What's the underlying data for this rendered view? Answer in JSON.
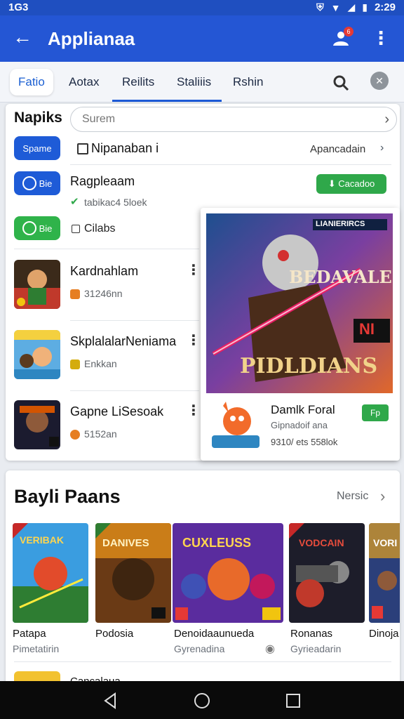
{
  "status": {
    "carrier": "1G3",
    "time": "2:29"
  },
  "appbar": {
    "title": "Applianaa",
    "badge": "6"
  },
  "tabs": [
    {
      "label": "Fatio"
    },
    {
      "label": "Aotax"
    },
    {
      "label": "Reilits"
    },
    {
      "label": "Staliiis"
    },
    {
      "label": "Rshin"
    }
  ],
  "section1": {
    "title": "Napiks",
    "search_placeholder": "Surem",
    "rows": [
      {
        "pill": "Spame",
        "label": "Nipanaban i",
        "link": "Apancadain"
      },
      {
        "pill": "Bie",
        "label": "Ragpleaam",
        "sub": "tabikac4 5loek",
        "button": "Cacadoo"
      },
      {
        "pill": "Bie",
        "label": "Cilabs"
      }
    ],
    "apps": [
      {
        "name": "Kardnahlam",
        "meta": "31246nn"
      },
      {
        "name": "SkplalalarNeniama",
        "meta": "Enkkan"
      },
      {
        "name": "Gapne LiSesoak",
        "meta": "5152an"
      }
    ]
  },
  "popup": {
    "art_title_top": "LIANIERIRCS",
    "art_title_mid": "BEDAVALEI",
    "art_title_bottom": "PIDLDIANS",
    "art_badge": "NI",
    "name": "Damlk Foral",
    "sub": "Gipnadoif ana",
    "meta": "9310/ ets 558lok",
    "button": "Fp"
  },
  "section2": {
    "title": "Bayli Paans",
    "more": "Nersic",
    "tiles": [
      {
        "art": "VERIBAK",
        "name": "Patapa",
        "sub": "Pimetatirin",
        "color1": "#3a9de0",
        "color2": "#e24b2b"
      },
      {
        "art": "DANIVES",
        "name": "Podosia",
        "sub": "",
        "color1": "#6a3a15",
        "color2": "#f39a1a"
      },
      {
        "art": "CUXLEUSS",
        "name": "Denoidaaunueda",
        "sub": "Gyrenadina",
        "color1": "#5a2c9e",
        "color2": "#e86a2a"
      },
      {
        "art": "VODCAIN",
        "name": "Ronanas",
        "sub": "Gyrieadarin",
        "color1": "#1d1d2a",
        "color2": "#c0392b"
      },
      {
        "art": "VORI",
        "name": "Dinoja",
        "sub": "",
        "color1": "#2b3f7a",
        "color2": "#e6a21f"
      }
    ],
    "peek_text": "Cancalaua"
  }
}
